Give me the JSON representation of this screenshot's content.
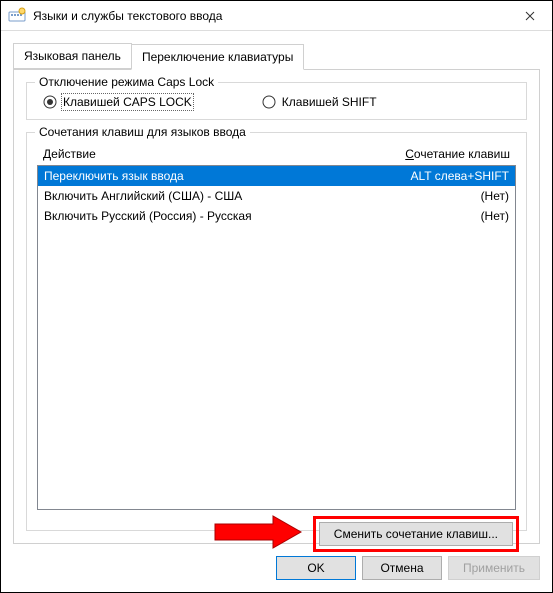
{
  "window": {
    "title": "Языки и службы текстового ввода"
  },
  "tabs": {
    "tab1": "Языковая панель",
    "tab2": "Переключение клавиатуры"
  },
  "capslock": {
    "group_title": "Отключение режима Caps Lock",
    "option1": "Клавишей CAPS LOCK",
    "option2": "Клавишей SHIFT"
  },
  "hotkeys": {
    "group_title": "Сочетания клавиш для языков ввода",
    "header_action_u": "Д",
    "header_action_rest": "ействие",
    "header_keys_u": "С",
    "header_keys_rest": "очетание клавиш",
    "rows": [
      {
        "action": "Переключить язык ввода",
        "keys": "ALT слева+SHIFT"
      },
      {
        "action": "Включить Английский (США) - США",
        "keys": "(Нет)"
      },
      {
        "action": "Включить Русский (Россия) - Русская",
        "keys": "(Нет)"
      }
    ],
    "change_btn": "Сменить сочетание клавиш..."
  },
  "footer": {
    "ok": "OK",
    "cancel": "Отмена",
    "apply": "Применить"
  }
}
